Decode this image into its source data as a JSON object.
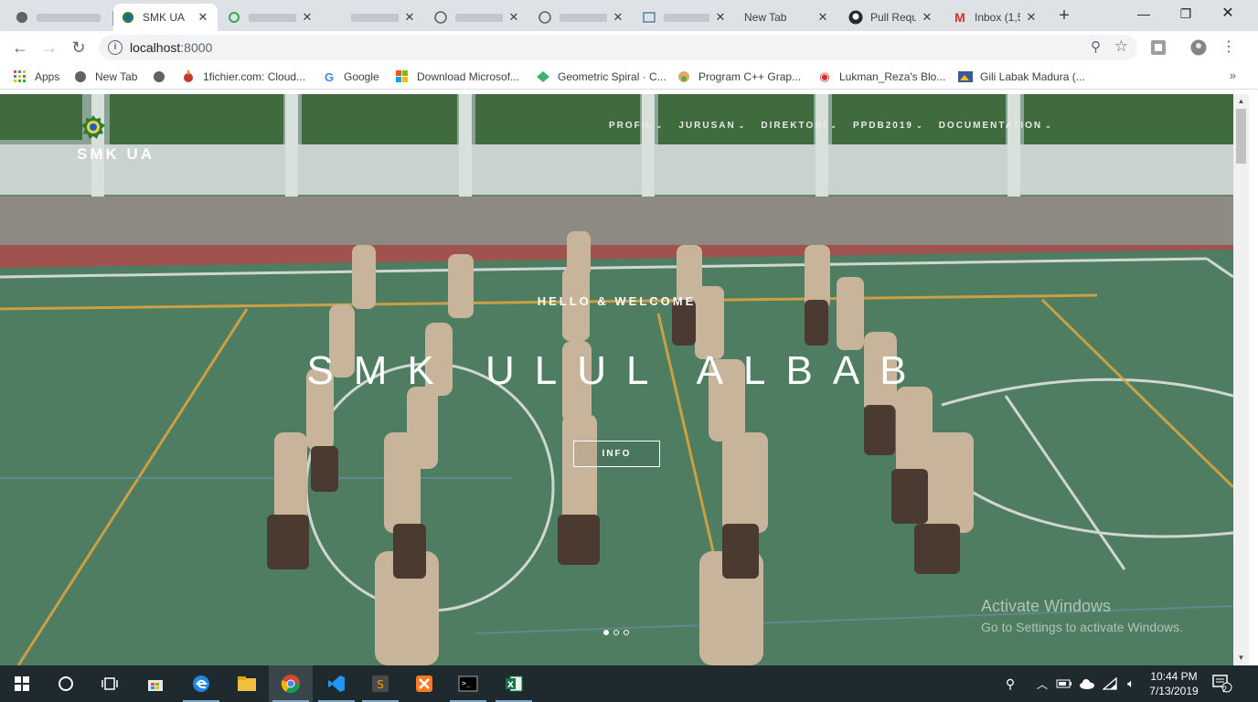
{
  "browser": {
    "tabs": [
      {
        "title": "",
        "redacted": true,
        "active": false
      },
      {
        "title": "SMK UA",
        "redacted": false,
        "active": true
      },
      {
        "title": "",
        "redacted": true,
        "active": false
      },
      {
        "title": "",
        "redacted": true,
        "active": false
      },
      {
        "title": "",
        "redacted": true,
        "active": false
      },
      {
        "title": "",
        "redacted": true,
        "active": false
      },
      {
        "title": "",
        "redacted": true,
        "active": false
      },
      {
        "title": "New Tab",
        "redacted": false,
        "active": false
      },
      {
        "title": "Pull Requ",
        "redacted": false,
        "active": false
      },
      {
        "title": "Inbox (1,5",
        "redacted": false,
        "active": false
      }
    ],
    "address": {
      "host": "localhost",
      "port": ":8000"
    },
    "bookmarks": [
      {
        "label": "Apps",
        "icon": "apps-grid-icon"
      },
      {
        "label": "New Tab",
        "icon": "globe-icon"
      },
      {
        "label": "",
        "icon": "globe-icon"
      },
      {
        "label": "1fichier.com: Cloud...",
        "icon": "1fichier-icon"
      },
      {
        "label": "Google",
        "icon": "google-icon"
      },
      {
        "label": "Download Microsof...",
        "icon": "microsoft-icon"
      },
      {
        "label": "Geometric Spiral · C...",
        "icon": "codepen-icon"
      },
      {
        "label": "Program C++ Grap...",
        "icon": "blog-icon"
      },
      {
        "label": "Lukman_Reza's Blo...",
        "icon": "wifi-blog-icon"
      },
      {
        "label": "Gili Labak Madura (...",
        "icon": "picture-icon"
      }
    ],
    "bookmarks_overflow": "»"
  },
  "site": {
    "brand": "SMK UA",
    "nav": [
      "PROFIL",
      "JURUSAN",
      "DIREKTORI",
      "PPDB2019",
      "DOCUMENTATION"
    ],
    "hero": {
      "welcome": "HELLO & WELCOME",
      "headline": "SMK ULUL ALBAB",
      "button": "INFO",
      "slides": 3,
      "active_slide": 1
    },
    "watermark": {
      "line1": "Activate Windows",
      "line2": "Go to Settings to activate Windows."
    }
  },
  "taskbar": {
    "apps": [
      "windows-start-icon",
      "cortana-icon",
      "task-view-icon",
      "store-icon",
      "edge-icon",
      "file-explorer-icon",
      "chrome-icon",
      "vscode-icon",
      "sublime-icon",
      "xampp-icon",
      "terminal-icon",
      "excel-icon"
    ],
    "time": "10:44 PM",
    "date": "7/13/2019",
    "notifications": "2"
  },
  "colors": {
    "tab_strip": "#dee1e6",
    "taskbar": "#1f2a2e",
    "hero_overlay": "#3f6e55"
  }
}
